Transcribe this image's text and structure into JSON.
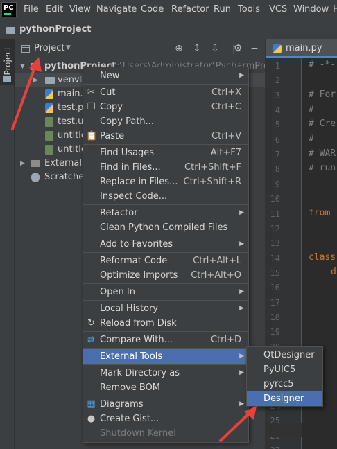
{
  "app": {
    "logo_text": "PC"
  },
  "menubar": {
    "items": [
      "File",
      "Edit",
      "View",
      "Navigate",
      "Code",
      "Refactor",
      "Run",
      "Tools",
      "VCS",
      "Window",
      "H"
    ]
  },
  "navbar": {
    "project_name": "pythonProject"
  },
  "tool_strip": {
    "project_tab": "Project"
  },
  "project_panel": {
    "view_label": "Project",
    "tree": [
      {
        "label": "pythonProject",
        "path": "C:\\Users\\Administrator\\PycharmProject",
        "kind": "root"
      },
      {
        "label": "venv",
        "suffix": "li",
        "kind": "folder"
      },
      {
        "label": "main.p",
        "kind": "py"
      },
      {
        "label": "test.py",
        "kind": "py"
      },
      {
        "label": "test.ui",
        "kind": "ui"
      },
      {
        "label": "untitled",
        "kind": "ui"
      },
      {
        "label": "untitled",
        "kind": "ui"
      },
      {
        "label": "External L",
        "kind": "lib"
      },
      {
        "label": "Scratches",
        "kind": "scratch"
      }
    ]
  },
  "editor": {
    "tab_label": "main.py",
    "line_numbers": [
      "1",
      "2",
      "3",
      "4",
      "5",
      "6",
      "7",
      "8",
      "9",
      "10",
      "11",
      "12",
      "13",
      "14",
      "15",
      "16",
      "17",
      "18",
      "19",
      "20",
      "21",
      "22",
      "23",
      "24",
      "25",
      "26",
      "27"
    ],
    "code_lines": [
      {
        "line": 1,
        "text": "# -*-",
        "style": "comment"
      },
      {
        "line": 3,
        "text": "# For",
        "style": "comment"
      },
      {
        "line": 4,
        "text": "#",
        "style": "comment"
      },
      {
        "line": 5,
        "text": "# Cre",
        "style": "comment"
      },
      {
        "line": 6,
        "text": "#",
        "style": "comment"
      },
      {
        "line": 7,
        "text": "# WAR",
        "style": "comment"
      },
      {
        "line": 8,
        "text": "# run",
        "style": "comment"
      },
      {
        "line": 11,
        "text": "from",
        "style": "keyword"
      },
      {
        "line": 14,
        "text": "class",
        "style": "keyword"
      },
      {
        "line": 15,
        "text": "d",
        "style": "keyword"
      }
    ]
  },
  "context_menu": {
    "items": [
      {
        "label": "New",
        "submenu": true
      },
      {
        "sep": true
      },
      {
        "label": "Cut",
        "shortcut": "Ctrl+X",
        "icon": "scissors-icon"
      },
      {
        "label": "Copy",
        "shortcut": "Ctrl+C",
        "icon": "copy-icon"
      },
      {
        "label": "Copy Path...",
        "shortcut": ""
      },
      {
        "label": "Paste",
        "shortcut": "Ctrl+V",
        "icon": "paste-icon"
      },
      {
        "sep": true
      },
      {
        "label": "Find Usages",
        "shortcut": "Alt+F7"
      },
      {
        "label": "Find in Files...",
        "shortcut": "Ctrl+Shift+F"
      },
      {
        "label": "Replace in Files...",
        "shortcut": "Ctrl+Shift+R"
      },
      {
        "label": "Inspect Code..."
      },
      {
        "sep": true
      },
      {
        "label": "Refactor",
        "submenu": true
      },
      {
        "label": "Clean Python Compiled Files"
      },
      {
        "sep": true
      },
      {
        "label": "Add to Favorites",
        "submenu": true
      },
      {
        "sep": true
      },
      {
        "label": "Reformat Code",
        "shortcut": "Ctrl+Alt+L"
      },
      {
        "label": "Optimize Imports",
        "shortcut": "Ctrl+Alt+O"
      },
      {
        "sep": true
      },
      {
        "label": "Open In",
        "submenu": true
      },
      {
        "sep": true
      },
      {
        "label": "Local History",
        "submenu": true
      },
      {
        "label": "Reload from Disk",
        "icon": "reload-icon"
      },
      {
        "sep": true
      },
      {
        "label": "Compare With...",
        "shortcut": "Ctrl+D",
        "icon": "compare-icon"
      },
      {
        "sep": true
      },
      {
        "label": "External Tools",
        "submenu": true,
        "selected": true
      },
      {
        "sep": true
      },
      {
        "label": "Mark Directory as",
        "submenu": true
      },
      {
        "label": "Remove BOM"
      },
      {
        "sep": true
      },
      {
        "label": "Diagrams",
        "submenu": true,
        "icon": "diagram-icon"
      },
      {
        "label": "Create Gist...",
        "icon": "github-icon"
      },
      {
        "label": "Shutdown Kernel",
        "disabled": true
      }
    ]
  },
  "external_tools_submenu": {
    "items": [
      {
        "label": "QtDesigner"
      },
      {
        "label": "PyUIC5"
      },
      {
        "label": "pyrcc5"
      },
      {
        "label": "Designer",
        "selected": true
      }
    ]
  },
  "colors": {
    "menu_bg": "#3c3f41",
    "selection": "#4b6eaf",
    "annotation_arrow": "#e8413b",
    "editor_bg": "#2b2b2b"
  }
}
